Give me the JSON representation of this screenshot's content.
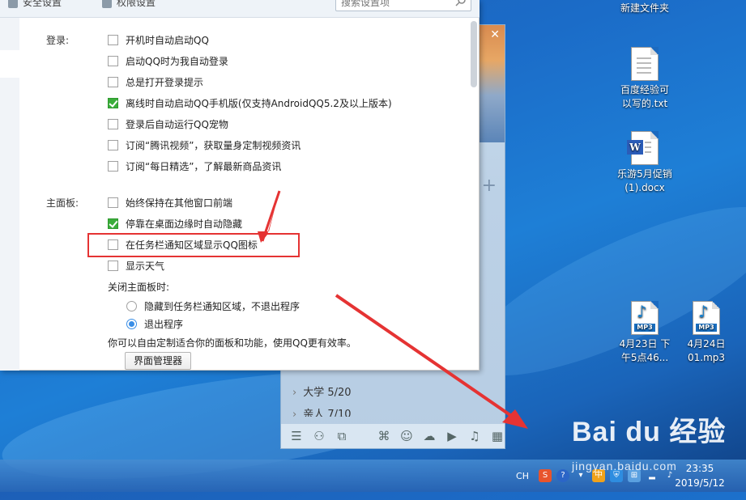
{
  "settings": {
    "tabs": [
      "安全设置",
      "权限设置"
    ],
    "search_placeholder": "搜索设置项",
    "login_label": "登录:",
    "login_options": [
      {
        "label": "开机时自动启动QQ",
        "checked": false
      },
      {
        "label": "启动QQ时为我自动登录",
        "checked": false
      },
      {
        "label": "总是打开登录提示",
        "checked": false
      },
      {
        "label": "离线时自动启动QQ手机版(仅支持AndroidQQ5.2及以上版本)",
        "checked": true
      },
      {
        "label": "登录后自动运行QQ宠物",
        "checked": false
      },
      {
        "label": "订阅“腾讯视频”，获取量身定制视频资讯",
        "checked": false
      },
      {
        "label": "订阅“每日精选”，了解最新商品资讯",
        "checked": false
      }
    ],
    "panel_label": "主面板:",
    "panel_options": [
      {
        "label": "始终保持在其他窗口前端",
        "checked": false
      },
      {
        "label": "停靠在桌面边缘时自动隐藏",
        "checked": true
      },
      {
        "label": "在任务栏通知区域显示QQ图标",
        "checked": false
      },
      {
        "label": "显示天气",
        "checked": false
      }
    ],
    "close_label": "关闭主面板时:",
    "close_options": [
      {
        "label": "隐藏到任务栏通知区域，不退出程序",
        "selected": false
      },
      {
        "label": "退出程序",
        "selected": true
      }
    ],
    "custom_text": "你可以自由定制适合你的面板和功能，使用QQ更有效率。",
    "manager_button": "界面管理器"
  },
  "qq_panel": {
    "groups": [
      "大学 5/20",
      "亲人 7/10"
    ]
  },
  "desktop": {
    "icons": [
      {
        "label": "新建文件夹"
      },
      {
        "label": "百度经验可以写的.txt"
      },
      {
        "label": "乐游5月促销(1).docx"
      },
      {
        "label": "4月23日 下午5点46..."
      },
      {
        "label": "4月24日01.mp3"
      }
    ]
  },
  "taskbar": {
    "lang": "CH",
    "ime": "中",
    "time": "23:35",
    "date": "2019/5/12"
  },
  "watermark": {
    "logo": "Bai du 经验",
    "url": "jingyan.baidu.com"
  },
  "colors": {
    "accent": "#3bad3b",
    "annotation": "#e53333",
    "radio": "#3a8ee6"
  }
}
